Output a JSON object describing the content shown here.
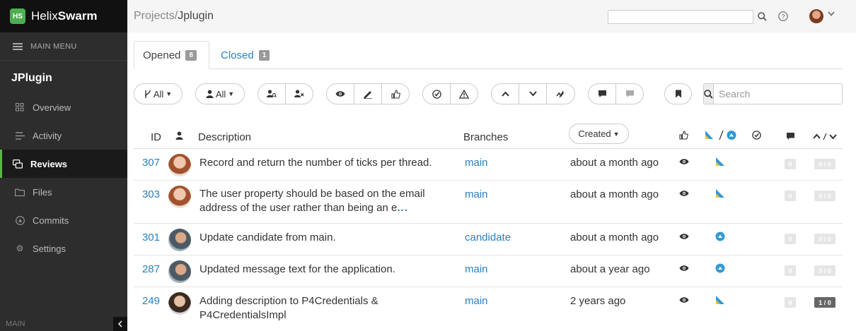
{
  "app": {
    "brand_light": "Helix",
    "brand_bold": "Swarm",
    "logo_glyph": "HS"
  },
  "sidebar": {
    "main_menu_label": "MAIN MENU",
    "project": "JPlugin",
    "items": [
      {
        "label": "Overview",
        "icon": "grid-icon",
        "active": false
      },
      {
        "label": "Activity",
        "icon": "activity-icon",
        "active": false
      },
      {
        "label": "Reviews",
        "icon": "reviews-icon",
        "active": true
      },
      {
        "label": "Files",
        "icon": "folder-icon",
        "active": false
      },
      {
        "label": "Commits",
        "icon": "commit-icon",
        "active": false
      },
      {
        "label": "Settings",
        "icon": "gear-icon",
        "active": false
      }
    ],
    "footer_label": "MAIN"
  },
  "header": {
    "breadcrumb_root": "Projects/",
    "breadcrumb_current": "Jplugin"
  },
  "tabs": [
    {
      "label": "Opened",
      "count": "8"
    },
    {
      "label": "Closed",
      "count": "1"
    }
  ],
  "filters": {
    "branch_label": "All",
    "user_label": "All",
    "search_placeholder": "Search"
  },
  "table": {
    "headers": {
      "id": "ID",
      "description": "Description",
      "branches": "Branches",
      "created": "Created"
    },
    "rows": [
      {
        "id": "307",
        "description": "Record and return the number of ticks per thread.",
        "more": "",
        "branch": "main",
        "created": "about a month ago",
        "state": "needs-review",
        "comments": "0",
        "votes": "0 / 0"
      },
      {
        "id": "303",
        "description": "The user property should be based on the email address of the user rather than being an e",
        "more": "...",
        "branch": "main",
        "created": "about a month ago",
        "state": "needs-review",
        "comments": "0",
        "votes": "0 / 0"
      },
      {
        "id": "301",
        "description": "Update candidate from main.",
        "more": "",
        "branch": "candidate",
        "created": "about a month ago",
        "state": "needs-revision",
        "comments": "0",
        "votes": "0 / 0"
      },
      {
        "id": "287",
        "description": "Updated message text for the application.",
        "more": "",
        "branch": "main",
        "created": "about a year ago",
        "state": "needs-revision",
        "comments": "0",
        "votes": "0 / 0"
      },
      {
        "id": "249",
        "description": "Adding description to P4Credentials & P4CredentialsImpl",
        "more": "",
        "branch": "main",
        "created": "2 years ago",
        "state": "needs-review",
        "comments": "0",
        "votes": "1 / 0"
      }
    ]
  },
  "colors": {
    "accent": "#58b646",
    "link": "#2a7fc0",
    "state_blue": "#2f9bd6",
    "state_yellow": "#f0c040"
  }
}
